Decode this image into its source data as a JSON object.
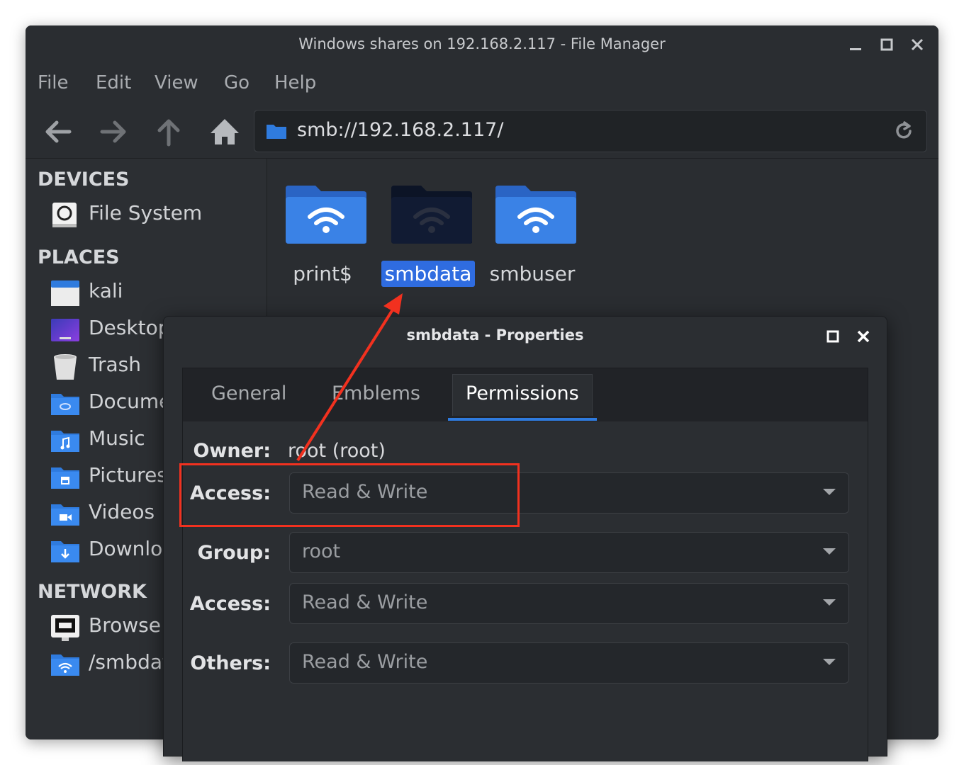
{
  "window": {
    "title": "Windows shares on 192.168.2.117 - File Manager"
  },
  "menu": [
    "File",
    "Edit",
    "View",
    "Go",
    "Help"
  ],
  "toolbar": {
    "address": "smb://192.168.2.117/",
    "icons": [
      "back-arrow-icon",
      "forward-arrow-icon",
      "up-arrow-icon",
      "home-icon",
      "reload-icon"
    ]
  },
  "sidebar": {
    "devices_heading": "DEVICES",
    "places_heading": "PLACES",
    "network_heading": "NETWORK",
    "devices": [
      {
        "label": "File System",
        "icon": "drive-icon"
      }
    ],
    "places": [
      {
        "label": "kali",
        "icon": "home-folder-icon"
      },
      {
        "label": "Desktop",
        "icon": "desktop-icon"
      },
      {
        "label": "Trash",
        "icon": "trash-icon"
      },
      {
        "label": "Docume",
        "icon": "documents-folder-icon"
      },
      {
        "label": "Music",
        "icon": "music-folder-icon"
      },
      {
        "label": "Pictures",
        "icon": "pictures-folder-icon"
      },
      {
        "label": "Videos",
        "icon": "videos-folder-icon"
      },
      {
        "label": "Downlo:",
        "icon": "downloads-folder-icon"
      }
    ],
    "network": [
      {
        "label": "Browse",
        "icon": "network-icon"
      },
      {
        "label": "/smbdat",
        "icon": "network-folder-icon"
      }
    ]
  },
  "files": [
    {
      "name": "print$",
      "selected": false
    },
    {
      "name": "smbdata",
      "selected": true
    },
    {
      "name": "smbuser",
      "selected": false
    }
  ],
  "dialog": {
    "title": "smbdata - Properties",
    "tabs": [
      "General",
      "Emblems",
      "Permissions"
    ],
    "active_tab": "Permissions",
    "owner_label": "Owner:",
    "owner_value": "root (root)",
    "access_label": "Access:",
    "owner_access": "Read & Write",
    "group_label": "Group:",
    "group_value": "root",
    "group_access_label": "Access:",
    "group_access": "Read & Write",
    "others_label": "Others:",
    "others_access": "Read & Write"
  },
  "colors": {
    "accent": "#2f7bde",
    "selection": "#2f6ce0",
    "annotation": "#f2311f",
    "folder": "#3a82e6"
  }
}
